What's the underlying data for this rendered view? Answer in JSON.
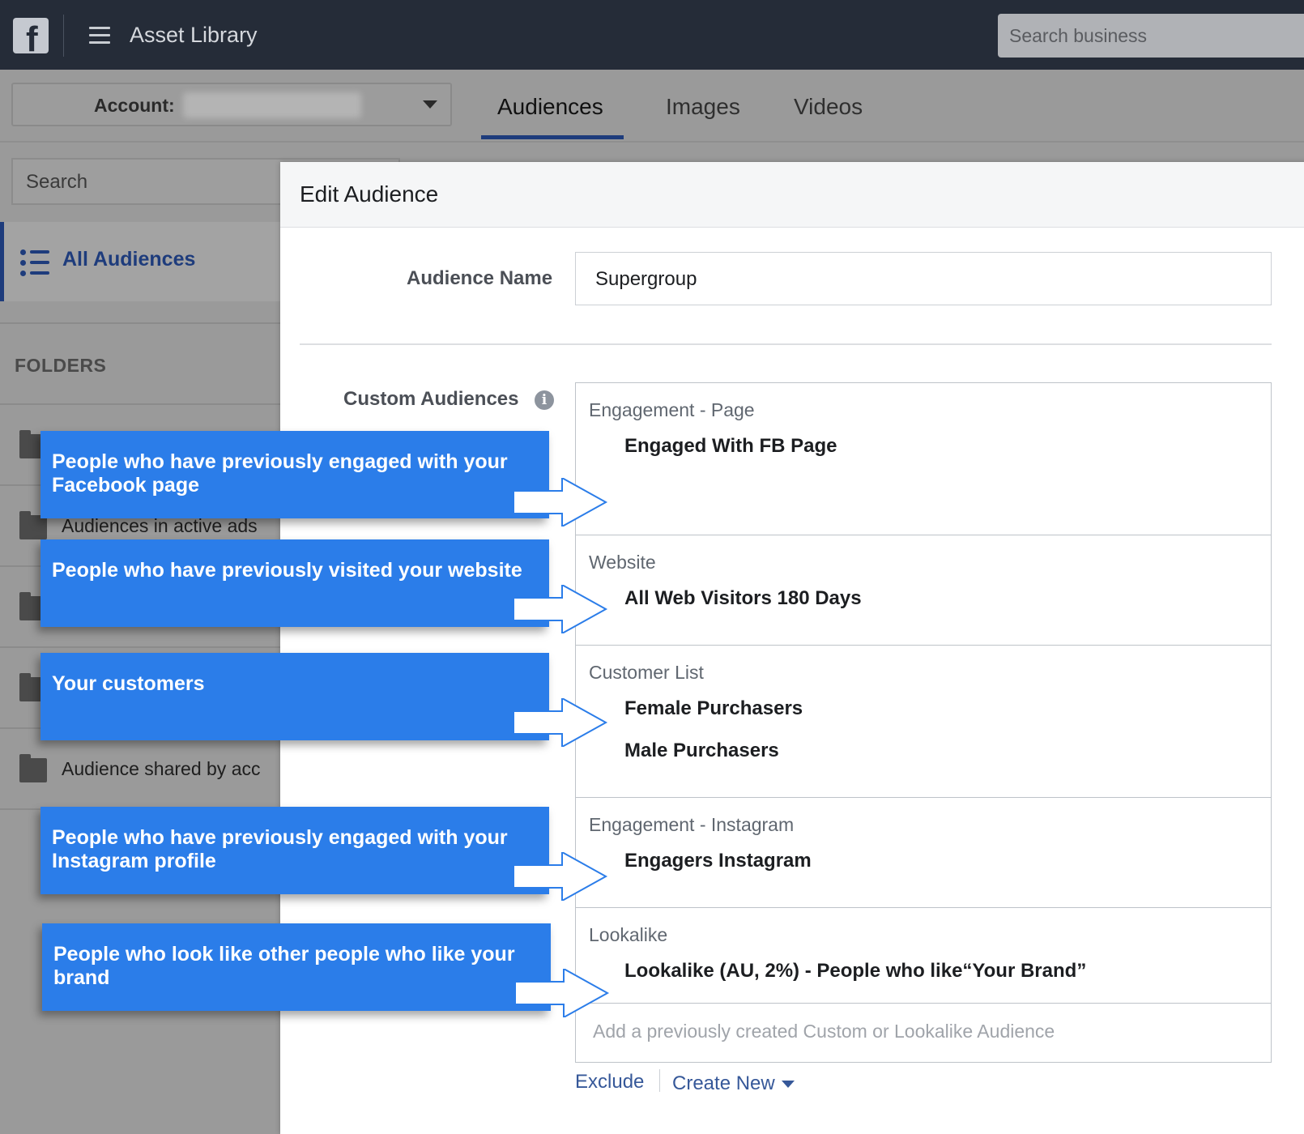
{
  "topbar": {
    "logo_letter": "f",
    "app_title": "Asset Library",
    "search_placeholder": "Search business"
  },
  "account": {
    "label": "Account:"
  },
  "tabs": [
    "Audiences",
    "Images",
    "Videos"
  ],
  "sidebar": {
    "search_placeholder": "Search",
    "all_audiences": "All Audiences",
    "folders_heading": "FOLDERS",
    "folders": [
      "Audiences in active ads",
      "Audience shared by acc"
    ]
  },
  "modal": {
    "title": "Edit Audience",
    "name_label": "Audience Name",
    "name_value": "Supergroup",
    "custom_label": "Custom Audiences",
    "info_icon": "i",
    "sections": [
      {
        "category": "Engagement - Page",
        "items": [
          "Engaged With FB Page"
        ]
      },
      {
        "category": "Website",
        "items": [
          "All Web Visitors 180 Days"
        ]
      },
      {
        "category": "Customer List",
        "items": [
          "Female Purchasers",
          "Male Purchasers"
        ]
      },
      {
        "category": "Engagement - Instagram",
        "items": [
          "Engagers Instagram"
        ]
      },
      {
        "category": "Lookalike",
        "items": [
          "Lookalike (AU, 2%) - People who like“Your Brand”"
        ]
      }
    ],
    "add_placeholder": "Add a previously created Custom or Lookalike Audience",
    "exclude_label": "Exclude",
    "create_new_label": "Create New"
  },
  "callouts": [
    "People who have previously engaged with your Facebook page",
    "People who have previously visited your website",
    "Your customers",
    "People who have previously engaged with your Instagram profile",
    "People who look like other people who like your brand"
  ],
  "colors": {
    "callout_blue": "#2b7de9",
    "link_blue": "#365899",
    "topbar": "#252c38"
  }
}
